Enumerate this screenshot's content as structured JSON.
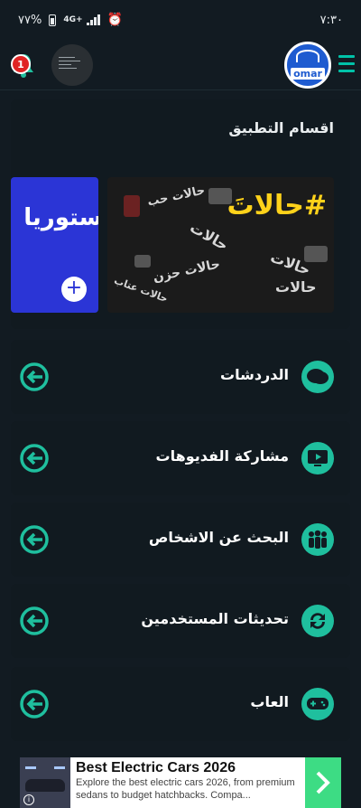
{
  "status_bar": {
    "battery": "٧٧%",
    "network": "4G+",
    "time": "٧:٣٠"
  },
  "app_bar": {
    "notification_count": "1",
    "logo_text": "omar"
  },
  "sections": {
    "title": "اقسام التطبيق",
    "cards": [
      {
        "headline": "#حالاتَ",
        "words": [
          "حالات حب",
          "حالات",
          "حالات حزن",
          "حالات عتاب",
          "حالات",
          "حالات"
        ]
      },
      {
        "headline": "#ستوريا"
      }
    ]
  },
  "features": [
    {
      "label": "الدردشات",
      "icon": "chat-bubbles-icon"
    },
    {
      "label": "مشاركة الفديوهات",
      "icon": "video-play-icon"
    },
    {
      "label": "البحث عن الاشخاص",
      "icon": "people-group-icon"
    },
    {
      "label": "تحديثات المستخدمين",
      "icon": "refresh-icon"
    },
    {
      "label": "العاب",
      "icon": "gamepad-icon"
    }
  ],
  "ad": {
    "title": "Best Electric Cars 2026",
    "description": "Explore the best electric cars 2026, from premium sedans to budget hatchbacks. Compa...",
    "info_symbol": "i"
  },
  "colors": {
    "background": "#121b22",
    "accent": "#1fbf9e",
    "card": "#111a20",
    "badge": "#e02424"
  }
}
